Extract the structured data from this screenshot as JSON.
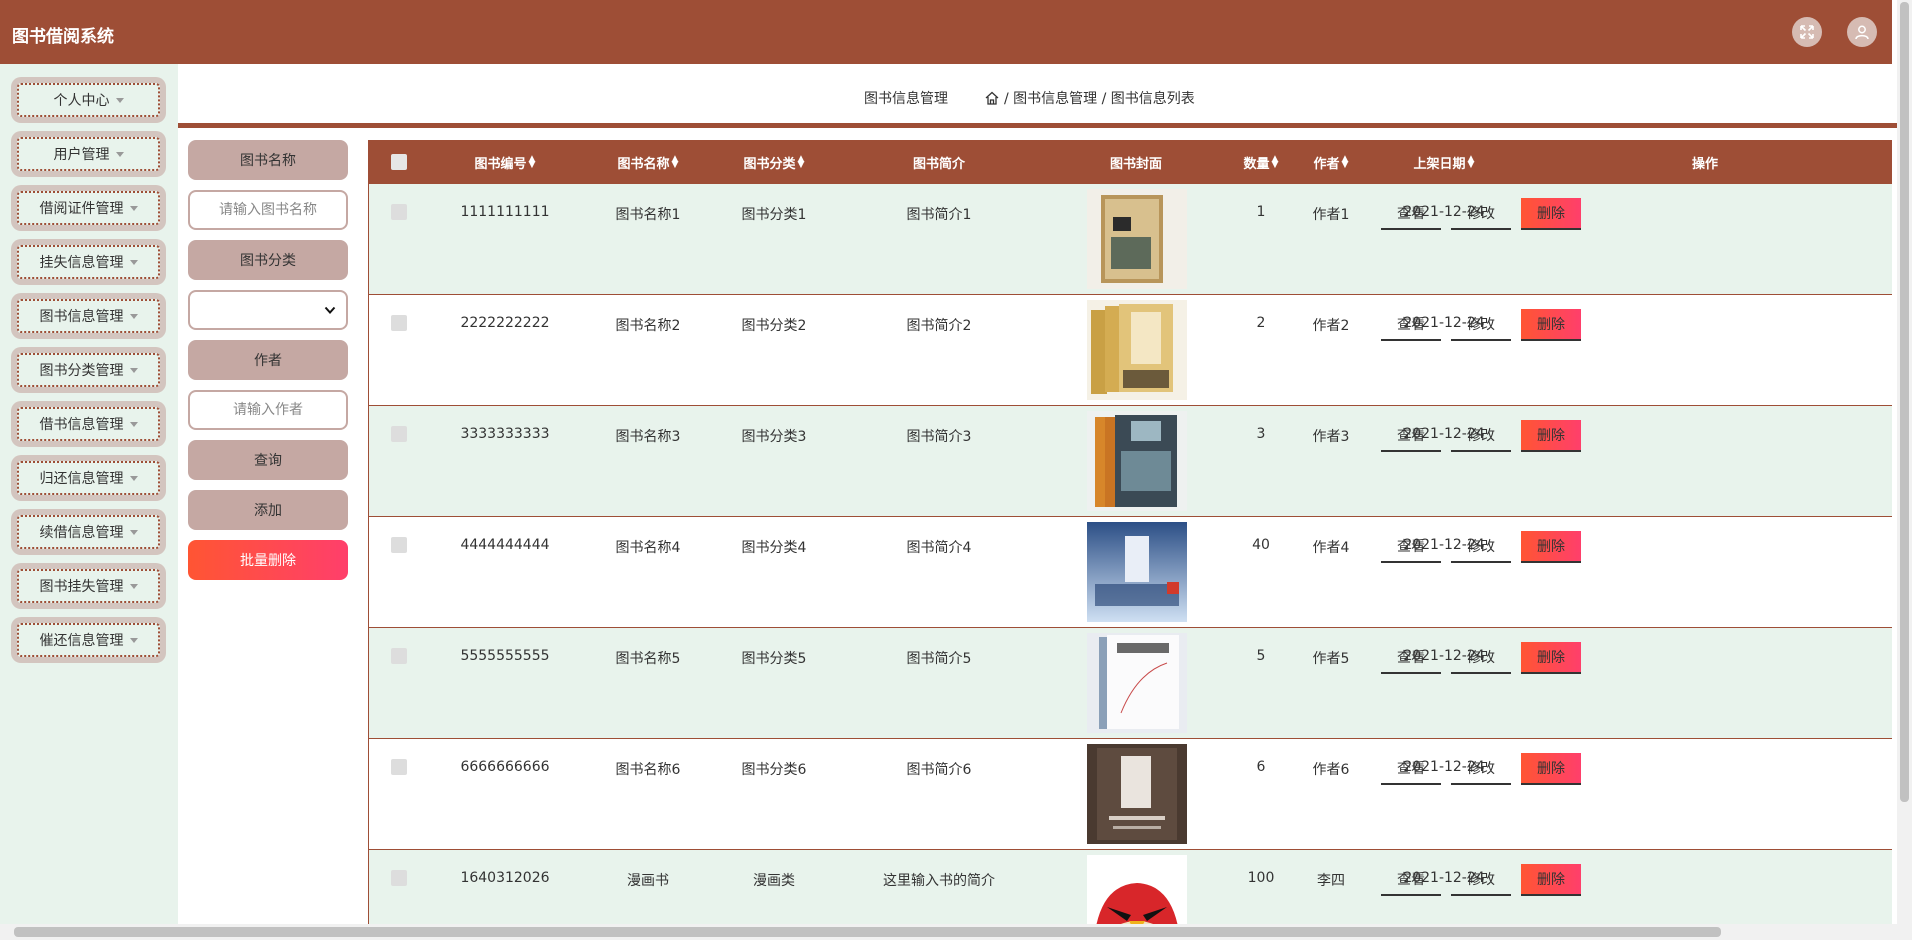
{
  "header": {
    "app_title": "图书借阅系统",
    "fullscreen_icon": "expand-icon",
    "user_icon": "user-icon"
  },
  "sidebar": {
    "items": [
      {
        "label": "个人中心"
      },
      {
        "label": "用户管理"
      },
      {
        "label": "借阅证件管理"
      },
      {
        "label": "挂失信息管理"
      },
      {
        "label": "图书信息管理"
      },
      {
        "label": "图书分类管理"
      },
      {
        "label": "借书信息管理"
      },
      {
        "label": "归还信息管理"
      },
      {
        "label": "续借信息管理"
      },
      {
        "label": "图书挂失管理"
      },
      {
        "label": "催还信息管理"
      }
    ]
  },
  "breadcrumb": {
    "section_title": "图书信息管理",
    "home_icon": "home-icon",
    "path": "/ 图书信息管理 / 图书信息列表"
  },
  "filters": {
    "name_label": "图书名称",
    "name_placeholder": "请输入图书名称",
    "category_label": "图书分类",
    "category_value": "",
    "author_label": "作者",
    "author_placeholder": "请输入作者",
    "search_label": "查询",
    "add_label": "添加",
    "batch_delete_label": "批量删除"
  },
  "table": {
    "columns": {
      "id": "图书编号",
      "name": "图书名称",
      "category": "图书分类",
      "intro": "图书简介",
      "cover": "图书封面",
      "quantity": "数量",
      "author": "作者",
      "date": "上架日期",
      "actions": "操作"
    },
    "action_labels": {
      "view": "查看",
      "edit": "修改",
      "delete": "删除"
    },
    "rows": [
      {
        "id": "1111111111",
        "name": "图书名称1",
        "category": "图书分类1",
        "intro": "图书简介1",
        "quantity": "1",
        "author": "作者1",
        "date": "2021-12-24"
      },
      {
        "id": "2222222222",
        "name": "图书名称2",
        "category": "图书分类2",
        "intro": "图书简介2",
        "quantity": "2",
        "author": "作者2",
        "date": "2021-12-24"
      },
      {
        "id": "3333333333",
        "name": "图书名称3",
        "category": "图书分类3",
        "intro": "图书简介3",
        "quantity": "3",
        "author": "作者3",
        "date": "2021-12-24"
      },
      {
        "id": "4444444444",
        "name": "图书名称4",
        "category": "图书分类4",
        "intro": "图书简介4",
        "quantity": "40",
        "author": "作者4",
        "date": "2021-12-24"
      },
      {
        "id": "5555555555",
        "name": "图书名称5",
        "category": "图书分类5",
        "intro": "图书简介5",
        "quantity": "5",
        "author": "作者5",
        "date": "2021-12-24"
      },
      {
        "id": "6666666666",
        "name": "图书名称6",
        "category": "图书分类6",
        "intro": "图书简介6",
        "quantity": "6",
        "author": "作者6",
        "date": "2021-12-24"
      },
      {
        "id": "1640312026",
        "name": "漫画书",
        "category": "漫画类",
        "intro": "这里输入书的简介",
        "quantity": "100",
        "author": "李四",
        "date": "2021-12-24"
      }
    ]
  },
  "colors": {
    "brand": "#9e4e36",
    "sidebar_bg": "#e8f3ec",
    "button_muted": "#c5a8a3",
    "danger": "#ff4a4a"
  }
}
